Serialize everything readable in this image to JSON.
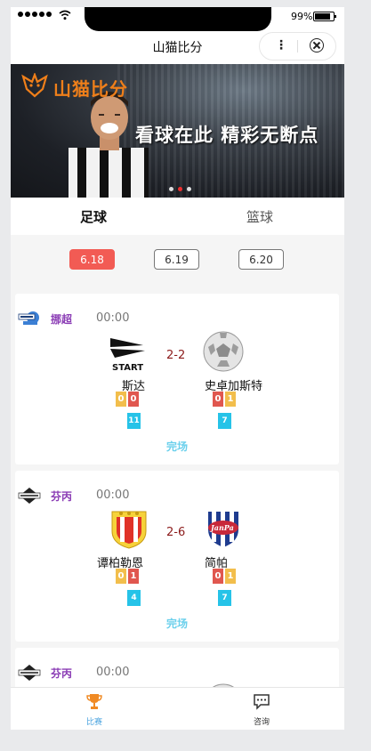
{
  "status_bar": {
    "battery": "99%"
  },
  "nav": {
    "title": "山猫比分"
  },
  "banner": {
    "brand": "山猫比分",
    "slogan": "看球在此 精彩无断点"
  },
  "tabs": [
    {
      "label": "足球",
      "active": true
    },
    {
      "label": "篮球",
      "active": false
    }
  ],
  "dates": [
    {
      "label": "6.18",
      "selected": true
    },
    {
      "label": "6.19",
      "selected": false
    },
    {
      "label": "6.20",
      "selected": false
    }
  ],
  "matches": [
    {
      "league": "挪超",
      "time": "00:00",
      "score": "2-2",
      "home": {
        "name": "斯达",
        "yellow": "0",
        "red": "0",
        "corners": "11"
      },
      "away": {
        "name": "史卓加斯特",
        "red": "0",
        "yellow": "1",
        "corners": "7"
      },
      "status": "完场"
    },
    {
      "league": "芬丙",
      "time": "00:00",
      "score": "2-6",
      "home": {
        "name": "谭柏勒恩",
        "yellow": "0",
        "red": "1",
        "corners": "4"
      },
      "away": {
        "name": "简帕",
        "red": "0",
        "yellow": "1",
        "corners": "7"
      },
      "status": "完场"
    },
    {
      "league": "芬丙",
      "time": "00:00"
    }
  ],
  "tabbar": [
    {
      "label": "比赛",
      "active": true
    },
    {
      "label": "咨询",
      "active": false
    }
  ],
  "colors": {
    "accent": "#f25b54",
    "league": "#8b3db5",
    "status": "#6bd0ec",
    "brand_orange": "#ef7f1a"
  }
}
